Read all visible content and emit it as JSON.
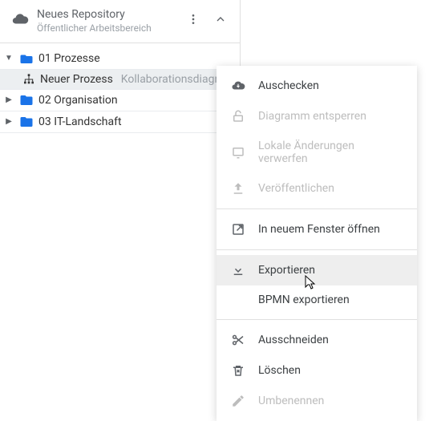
{
  "header": {
    "title": "Neues Repository",
    "subtitle": "Öffentlicher Arbeitsbereich"
  },
  "tree": {
    "n0": {
      "label": "01 Prozesse"
    },
    "n0_0": {
      "label": "Neuer Prozess",
      "hint": "Kollaborationsdiagra."
    },
    "n1": {
      "label": "02 Organisation"
    },
    "n2": {
      "label": "03 IT-Landschaft"
    }
  },
  "menu": {
    "checkout": "Auschecken",
    "unlock": "Diagramm entsperren",
    "discard": "Lokale Änderungen verwerfen",
    "publish": "Veröffentlichen",
    "newwin": "In neuem Fenster öffnen",
    "export": "Exportieren",
    "bpmn": "BPMN exportieren",
    "cut": "Ausschneiden",
    "delete": "Löschen",
    "rename": "Umbenennen"
  }
}
